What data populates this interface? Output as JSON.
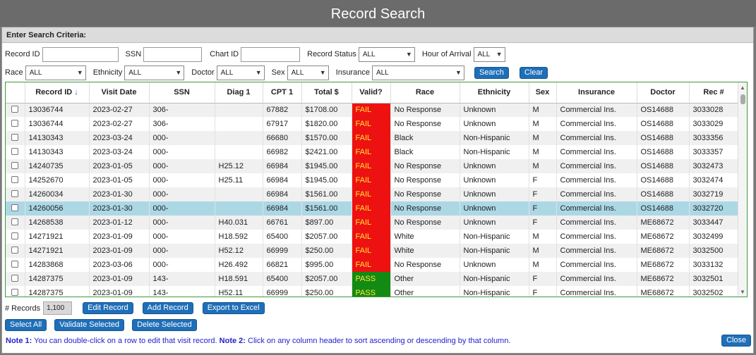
{
  "window": {
    "title": "Record Search"
  },
  "criteria": {
    "heading": "Enter Search Criteria:",
    "record_id_label": "Record ID",
    "ssn_label": "SSN",
    "chart_id_label": "Chart ID",
    "record_status_label": "Record Status",
    "record_status_value": "ALL",
    "hour_label": "Hour of Arrival",
    "hour_value": "ALL",
    "race_label": "Race",
    "race_value": "ALL",
    "ethnicity_label": "Ethnicity",
    "ethnicity_value": "ALL",
    "doctor_label": "Doctor",
    "doctor_value": "ALL",
    "sex_label": "Sex",
    "sex_value": "ALL",
    "insurance_label": "Insurance",
    "insurance_value": "ALL",
    "search_button": "Search",
    "clear_button": "Clear"
  },
  "grid": {
    "columns": [
      "Record ID",
      "Visit Date",
      "SSN",
      "Diag 1",
      "CPT 1",
      "Total $",
      "Valid?",
      "Race",
      "Ethnicity",
      "Sex",
      "Insurance",
      "Doctor",
      "Rec #"
    ],
    "sort_indicator": "↓",
    "rows": [
      {
        "id": "13036744",
        "date": "2023-02-27",
        "ssn": "306-",
        "diag": "",
        "cpt": "67882",
        "total": "$1708.00",
        "valid": "FAIL",
        "race": "No Response",
        "eth": "Unknown",
        "sex": "M",
        "ins": "Commercial Ins.",
        "doc": "OS14688",
        "rec": "3033028"
      },
      {
        "id": "13036744",
        "date": "2023-02-27",
        "ssn": "306-",
        "diag": "",
        "cpt": "67917",
        "total": "$1820.00",
        "valid": "FAIL",
        "race": "No Response",
        "eth": "Unknown",
        "sex": "M",
        "ins": "Commercial Ins.",
        "doc": "OS14688",
        "rec": "3033029"
      },
      {
        "id": "14130343",
        "date": "2023-03-24",
        "ssn": "000-",
        "diag": "",
        "cpt": "66680",
        "total": "$1570.00",
        "valid": "FAIL",
        "race": "Black",
        "eth": "Non-Hispanic",
        "sex": "M",
        "ins": "Commercial Ins.",
        "doc": "OS14688",
        "rec": "3033356"
      },
      {
        "id": "14130343",
        "date": "2023-03-24",
        "ssn": "000-",
        "diag": "",
        "cpt": "66982",
        "total": "$2421.00",
        "valid": "FAIL",
        "race": "Black",
        "eth": "Non-Hispanic",
        "sex": "M",
        "ins": "Commercial Ins.",
        "doc": "OS14688",
        "rec": "3033357"
      },
      {
        "id": "14240735",
        "date": "2023-01-05",
        "ssn": "000-",
        "diag": "H25.12",
        "cpt": "66984",
        "total": "$1945.00",
        "valid": "FAIL",
        "race": "No Response",
        "eth": "Unknown",
        "sex": "M",
        "ins": "Commercial Ins.",
        "doc": "OS14688",
        "rec": "3032473"
      },
      {
        "id": "14252670",
        "date": "2023-01-05",
        "ssn": "000-",
        "diag": "H25.11",
        "cpt": "66984",
        "total": "$1945.00",
        "valid": "FAIL",
        "race": "No Response",
        "eth": "Unknown",
        "sex": "F",
        "ins": "Commercial Ins.",
        "doc": "OS14688",
        "rec": "3032474"
      },
      {
        "id": "14260034",
        "date": "2023-01-30",
        "ssn": "000-",
        "diag": "",
        "cpt": "66984",
        "total": "$1561.00",
        "valid": "FAIL",
        "race": "No Response",
        "eth": "Unknown",
        "sex": "F",
        "ins": "Commercial Ins.",
        "doc": "OS14688",
        "rec": "3032719"
      },
      {
        "id": "14260056",
        "date": "2023-01-30",
        "ssn": "000-",
        "diag": "",
        "cpt": "66984",
        "total": "$1561.00",
        "valid": "FAIL",
        "race": "No Response",
        "eth": "Unknown",
        "sex": "F",
        "ins": "Commercial Ins.",
        "doc": "OS14688",
        "rec": "3032720",
        "selected": true
      },
      {
        "id": "14268538",
        "date": "2023-01-12",
        "ssn": "000-",
        "diag": "H40.031",
        "cpt": "66761",
        "total": "$897.00",
        "valid": "FAIL",
        "race": "No Response",
        "eth": "Unknown",
        "sex": "F",
        "ins": "Commercial Ins.",
        "doc": "ME68672",
        "rec": "3033447"
      },
      {
        "id": "14271921",
        "date": "2023-01-09",
        "ssn": "000-",
        "diag": "H18.592",
        "cpt": "65400",
        "total": "$2057.00",
        "valid": "FAIL",
        "race": "White",
        "eth": "Non-Hispanic",
        "sex": "M",
        "ins": "Commercial Ins.",
        "doc": "ME68672",
        "rec": "3032499"
      },
      {
        "id": "14271921",
        "date": "2023-01-09",
        "ssn": "000-",
        "diag": "H52.12",
        "cpt": "66999",
        "total": "$250.00",
        "valid": "FAIL",
        "race": "White",
        "eth": "Non-Hispanic",
        "sex": "M",
        "ins": "Commercial Ins.",
        "doc": "ME68672",
        "rec": "3032500"
      },
      {
        "id": "14283868",
        "date": "2023-03-06",
        "ssn": "000-",
        "diag": "H26.492",
        "cpt": "66821",
        "total": "$995.00",
        "valid": "FAIL",
        "race": "No Response",
        "eth": "Unknown",
        "sex": "M",
        "ins": "Commercial Ins.",
        "doc": "ME68672",
        "rec": "3033132"
      },
      {
        "id": "14287375",
        "date": "2023-01-09",
        "ssn": "143-",
        "diag": "H18.591",
        "cpt": "65400",
        "total": "$2057.00",
        "valid": "PASS",
        "race": "Other",
        "eth": "Non-Hispanic",
        "sex": "F",
        "ins": "Commercial Ins.",
        "doc": "ME68672",
        "rec": "3032501"
      },
      {
        "id": "14287375",
        "date": "2023-01-09",
        "ssn": "143-",
        "diag": "H52.11",
        "cpt": "66999",
        "total": "$250.00",
        "valid": "PASS",
        "race": "Other",
        "eth": "Non-Hispanic",
        "sex": "F",
        "ins": "Commercial Ins.",
        "doc": "ME68672",
        "rec": "3032502"
      }
    ]
  },
  "footer": {
    "records_label": "# Records",
    "records_count": "1,100",
    "edit_record": "Edit Record",
    "add_record": "Add Record",
    "export_excel": "Export to Excel",
    "select_all": "Select All",
    "validate_selected": "Validate Selected",
    "delete_selected": "Delete Selected",
    "note1_label": "Note 1:",
    "note1_text": "You can double-click on a row to edit that visit record.",
    "note2_label": "Note 2:",
    "note2_text": "Click on any column header to sort ascending or descending by that column.",
    "close": "Close"
  },
  "colors": {
    "fail": "#ee1111",
    "pass": "#138a13",
    "selected_row": "#acd8e6",
    "button": "#1f6fb8"
  }
}
